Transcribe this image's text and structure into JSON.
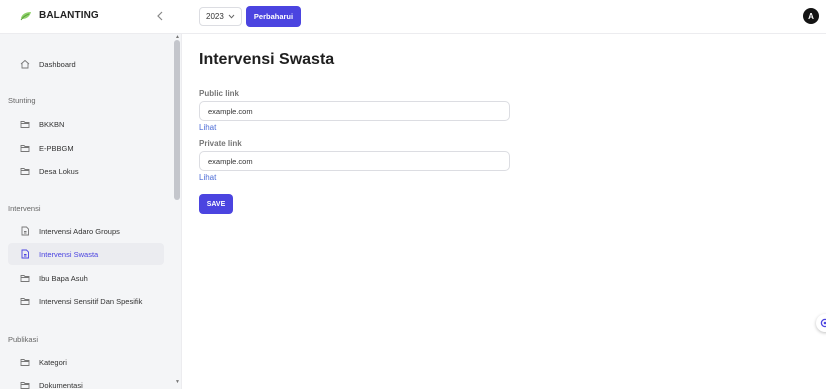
{
  "brand": {
    "name": "BALANTING"
  },
  "header": {
    "year": "2023",
    "refresh_label": "Perbaharui",
    "avatar_initial": "A"
  },
  "sidebar": {
    "items": [
      {
        "label": "Dashboard",
        "icon": "home-icon"
      },
      {
        "section": "Stunting"
      },
      {
        "label": "BKKBN",
        "icon": "folder-icon"
      },
      {
        "label": "E-PBBGM",
        "icon": "folder-icon"
      },
      {
        "label": "Desa Lokus",
        "icon": "folder-icon"
      },
      {
        "section": "Intervensi"
      },
      {
        "label": "Intervensi Adaro Groups",
        "icon": "document-icon"
      },
      {
        "label": "Intervensi Swasta",
        "icon": "document-icon",
        "active": true
      },
      {
        "label": "Ibu Bapa Asuh",
        "icon": "folder-icon"
      },
      {
        "label": "Intervensi Sensitif Dan Spesifik",
        "icon": "folder-icon"
      },
      {
        "section": "Publikasi"
      },
      {
        "label": "Kategori",
        "icon": "folder-icon"
      },
      {
        "label": "Dokumentasi",
        "icon": "folder-icon"
      }
    ]
  },
  "main": {
    "title": "Intervensi Swasta",
    "public": {
      "label": "Public link",
      "value": "example.com",
      "link_label": "Lihat"
    },
    "private": {
      "label": "Private link",
      "value": "example.com",
      "link_label": "Lihat"
    },
    "save_label": "SAVE"
  },
  "colors": {
    "accent": "#4b44e0",
    "link": "#4b6bd6"
  }
}
